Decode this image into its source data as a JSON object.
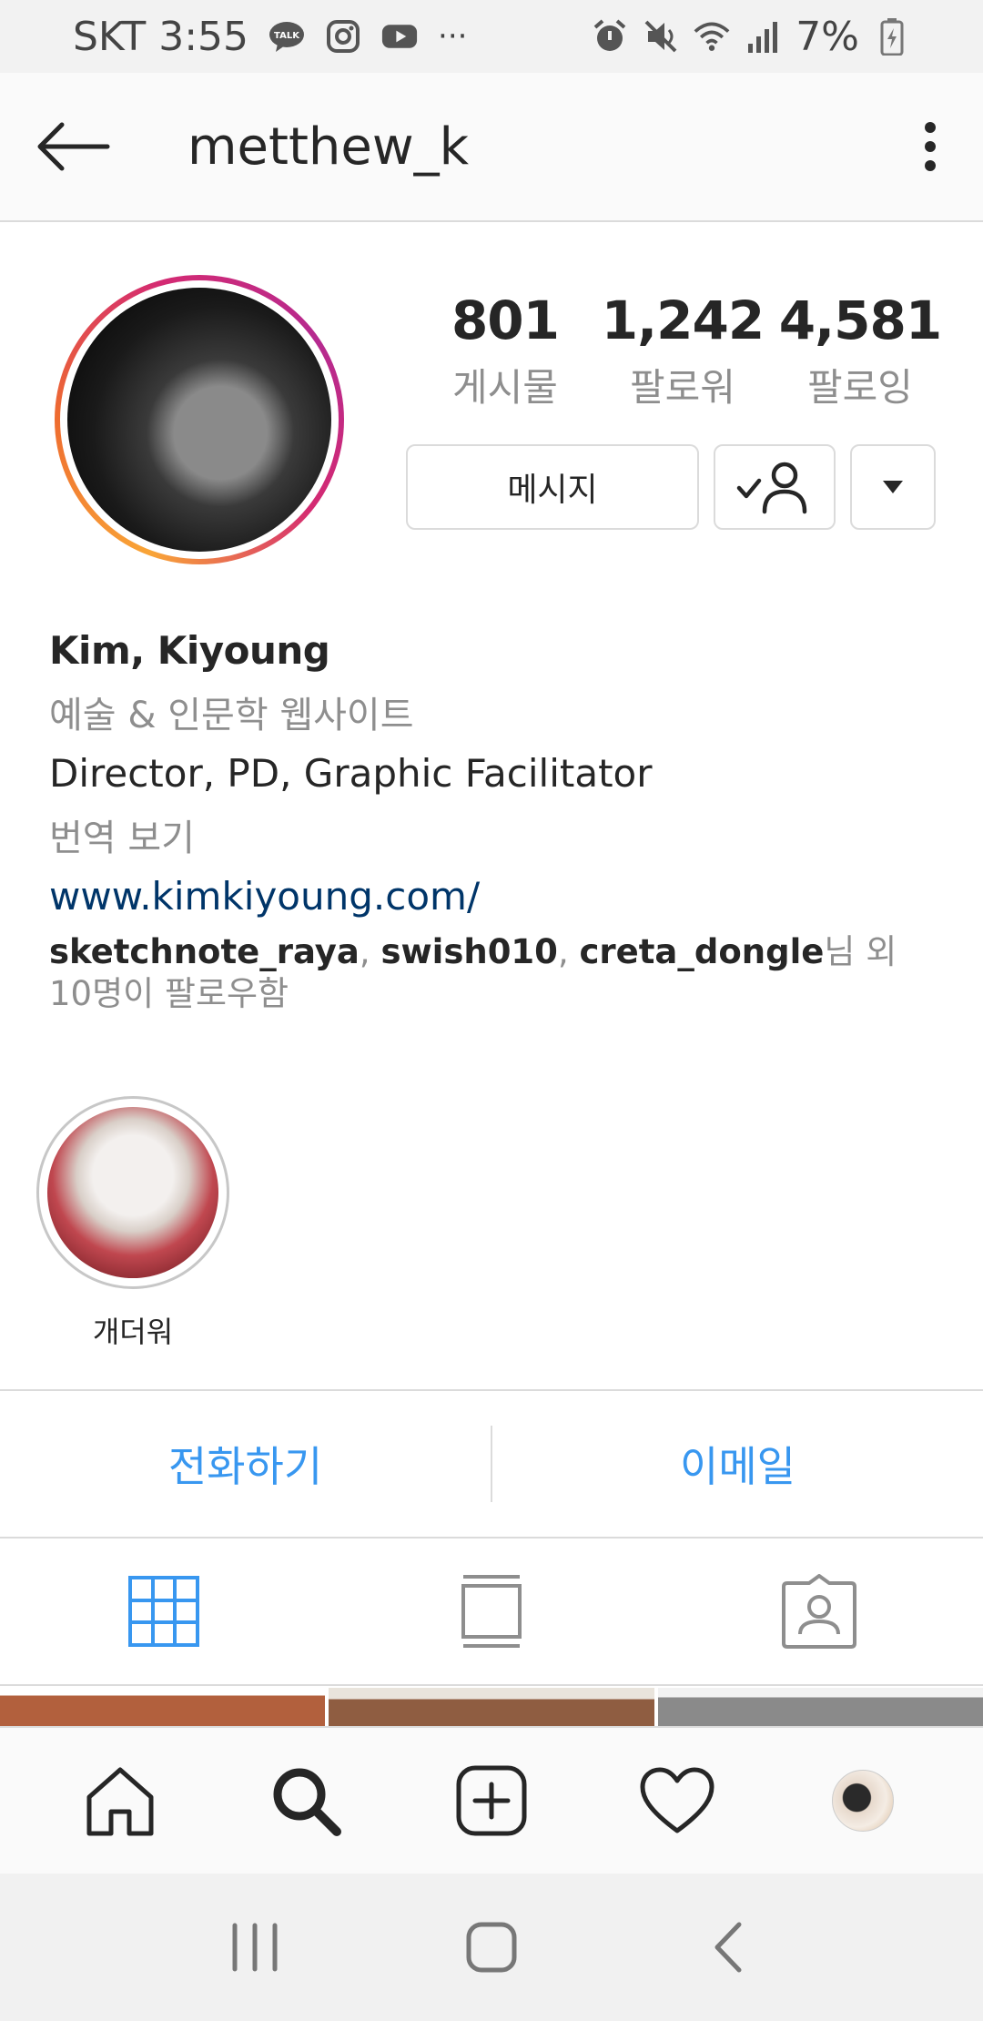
{
  "status_bar": {
    "carrier_time": "SKT 3:55",
    "overflow": "···",
    "battery": "7%",
    "icons": [
      "talk-icon",
      "instagram-icon",
      "youtube-icon",
      "alarm-icon",
      "mute-icon",
      "wifi-icon",
      "signal-icon",
      "battery-icon"
    ]
  },
  "header": {
    "username": "metthew_k"
  },
  "profile": {
    "stats": [
      {
        "value": "801",
        "label": "게시물"
      },
      {
        "value": "1,242",
        "label": "팔로워"
      },
      {
        "value": "4,581",
        "label": "팔로잉"
      }
    ],
    "buttons": {
      "message": "메시지"
    },
    "bio": {
      "name": "Kim, Kiyoung",
      "category": "예술 & 인문학 웹사이트",
      "description": "Director, PD, Graphic Facilitator",
      "translate": "번역 보기",
      "link": "www.kimkiyoung.com/",
      "followed_by_users": [
        "sketchnote_raya",
        "swish010",
        "creta_dongle"
      ],
      "followed_by_suffix": "님 외 10명이 팔로우함"
    }
  },
  "highlights": [
    {
      "label": "개더워"
    }
  ],
  "contact": {
    "call": "전화하기",
    "email": "이메일"
  },
  "colors": {
    "accent_blue": "#3897f0",
    "link_blue": "#003569",
    "text_primary": "#262626",
    "text_secondary": "#8e8e8e",
    "border": "#dbdbdb"
  }
}
